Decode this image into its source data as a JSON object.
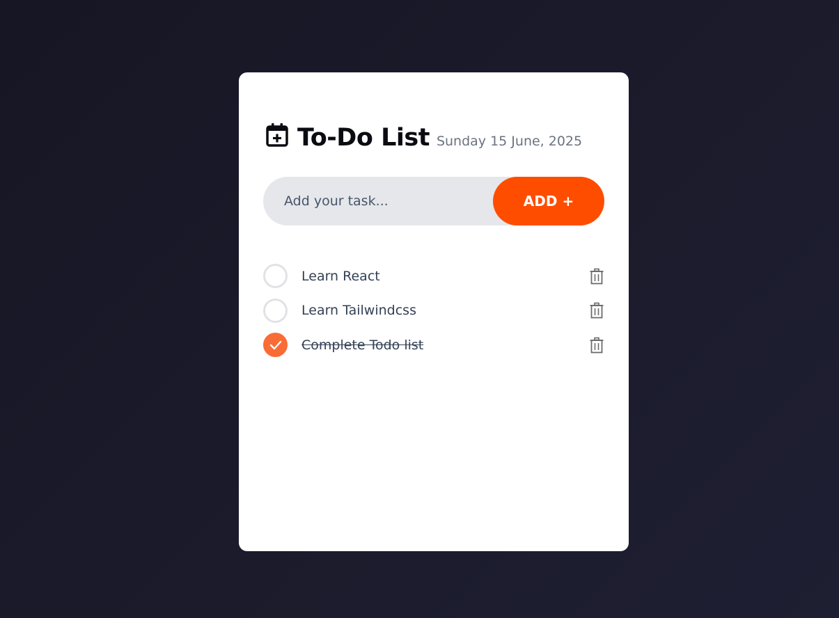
{
  "header": {
    "icon": "calendar-plus-icon",
    "title": "To-Do List",
    "date": "Sunday 15 June, 2025"
  },
  "input": {
    "placeholder": "Add your task...",
    "value": ""
  },
  "add_button": {
    "label": "ADD +",
    "color": "#ff4d00"
  },
  "tasks": [
    {
      "label": "Learn React",
      "completed": false
    },
    {
      "label": "Learn Tailwindcss",
      "completed": false
    },
    {
      "label": "Complete Todo list",
      "completed": true
    }
  ],
  "colors": {
    "accent": "#ff4d00",
    "check_done": "#f96c36",
    "card": "#ffffff",
    "background": "#1b1b2c"
  }
}
